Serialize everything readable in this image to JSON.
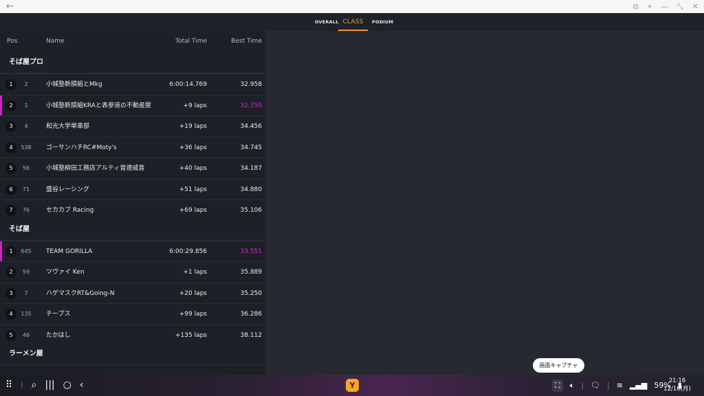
{
  "window": {
    "back_icon": "←",
    "controls": [
      "⧉",
      "⌖",
      "—",
      "⤡",
      "✕"
    ]
  },
  "tabs": [
    {
      "label": "OVERALL",
      "active": false
    },
    {
      "label": "CLASS",
      "active": true
    },
    {
      "label": "PODIUM",
      "active": false
    }
  ],
  "table": {
    "headers": {
      "pos": "Pos",
      "name": "Name",
      "total": "Total Time",
      "best": "Best Time"
    },
    "classes": [
      {
        "title": "そば屋プロ",
        "rows": [
          {
            "pos": "1",
            "num": "2",
            "name": "小城塾新撰組とMkg",
            "total": "6:00:14.769",
            "best": "32.958",
            "highlight": false,
            "fastest": false
          },
          {
            "pos": "2",
            "num": "1",
            "name": "小城塾新撰組KRAと表参道の不動産屋",
            "total": "+9 laps",
            "best": "32.750",
            "highlight": true,
            "fastest": true
          },
          {
            "pos": "3",
            "num": "4",
            "name": "和光大学単車部",
            "total": "+19 laps",
            "best": "34.456",
            "highlight": false,
            "fastest": false
          },
          {
            "pos": "4",
            "num": "538",
            "name": "ゴーサンハチRC#Moty's",
            "total": "+36 laps",
            "best": "34.745",
            "highlight": false,
            "fastest": false
          },
          {
            "pos": "5",
            "num": "56",
            "name": "小城塾柳田工務店アルティ音速威音",
            "total": "+40 laps",
            "best": "34.187",
            "highlight": false,
            "fastest": false
          },
          {
            "pos": "6",
            "num": "71",
            "name": "盛谷レーシング",
            "total": "+51 laps",
            "best": "34.880",
            "highlight": false,
            "fastest": false
          },
          {
            "pos": "7",
            "num": "76",
            "name": "セカカブ Racing",
            "total": "+69 laps",
            "best": "35.106",
            "highlight": false,
            "fastest": false
          }
        ]
      },
      {
        "title": "そば屋",
        "rows": [
          {
            "pos": "1",
            "num": "645",
            "name": "TEAM GORILLA",
            "total": "6:00:29.856",
            "best": "33.551",
            "highlight": true,
            "fastest": true
          },
          {
            "pos": "2",
            "num": "59",
            "name": "ツヴァイ Ken",
            "total": "+1 laps",
            "best": "35.889",
            "highlight": false,
            "fastest": false
          },
          {
            "pos": "3",
            "num": "7",
            "name": "ハゲマスクRT&Going-N",
            "total": "+20 laps",
            "best": "35.250",
            "highlight": false,
            "fastest": false
          },
          {
            "pos": "4",
            "num": "135",
            "name": "チープス",
            "total": "+99 laps",
            "best": "36.286",
            "highlight": false,
            "fastest": false
          },
          {
            "pos": "5",
            "num": "46",
            "name": "たかはし",
            "total": "+135 laps",
            "best": "38.112",
            "highlight": false,
            "fastest": false
          }
        ]
      },
      {
        "title": "ラーメン屋",
        "rows": []
      }
    ]
  },
  "tooltip": "画面キャプチャ",
  "taskbar": {
    "battery": "59%",
    "time": "21:16",
    "date": "12/16(月)",
    "app_letter": "Y"
  }
}
